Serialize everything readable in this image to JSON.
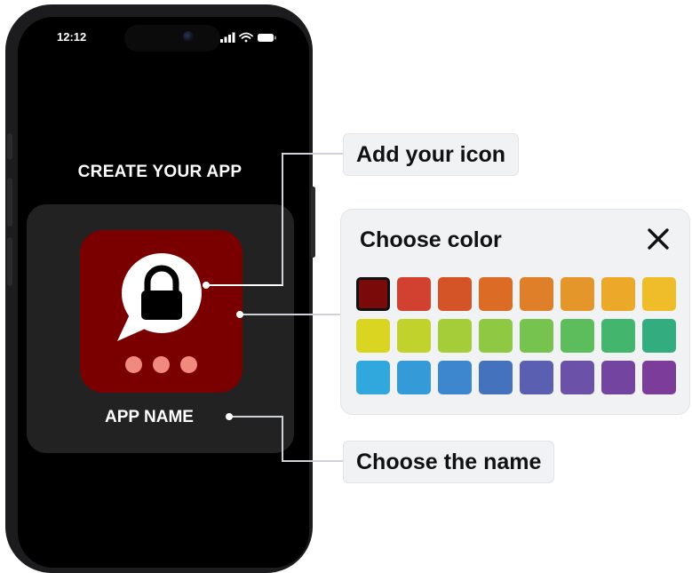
{
  "status_bar": {
    "time": "12:12"
  },
  "screen": {
    "title": "CREATE YOUR APP",
    "app_name": "APP NAME"
  },
  "app_icon": {
    "background": "#7a0000",
    "dot_color": "#f08a7e",
    "glyph": "padlock-in-speech-bubble"
  },
  "callouts": {
    "add_icon": "Add your icon",
    "choose_name": "Choose the name"
  },
  "color_panel": {
    "title": "Choose color",
    "close_icon": "close-icon",
    "selected_index": 0,
    "swatches": [
      "#7a0a0a",
      "#d2412f",
      "#d45428",
      "#dc6b26",
      "#e07f2a",
      "#e5962a",
      "#eba829",
      "#efbd29",
      "#d9d521",
      "#c2d22d",
      "#a5cd3a",
      "#8fc843",
      "#77c34f",
      "#5dbd5c",
      "#43b56c",
      "#33ad7f",
      "#30a8de",
      "#359ad8",
      "#3d87cf",
      "#4572bd",
      "#5a5fb1",
      "#6b52a8",
      "#7445a0",
      "#7c3c99"
    ]
  }
}
